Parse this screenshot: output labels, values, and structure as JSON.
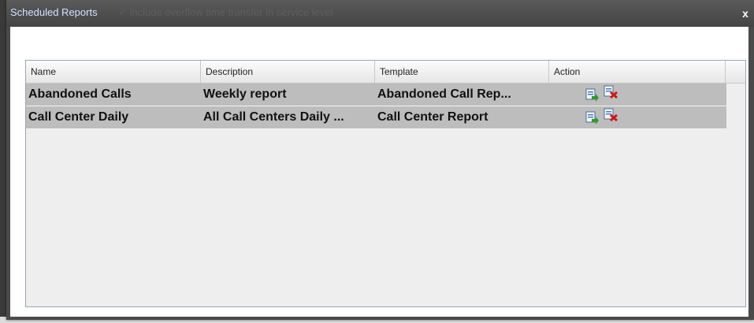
{
  "dialog": {
    "title": "Scheduled Reports",
    "background_text": "✓ include overflow time transfer in service level",
    "close_glyph": "x"
  },
  "grid": {
    "columns": [
      "Name",
      "Description",
      "Template",
      "Action"
    ],
    "rows": [
      {
        "name": "Abandoned Calls",
        "description": "Weekly report",
        "template": "Abandoned Call Rep...",
        "actions": [
          "edit-report-icon",
          "delete-report-icon"
        ]
      },
      {
        "name": "Call Center Daily",
        "description": "All Call Centers Daily ...",
        "template": "Call Center Report",
        "actions": [
          "edit-report-icon",
          "delete-report-icon"
        ]
      }
    ]
  },
  "colors": {
    "title_text": "#cfe3ff",
    "row_background": "#bdbdbd",
    "grid_background": "#eeeeee",
    "delete_icon": "#d01818",
    "edit_icon_arrow": "#2f9a2f"
  }
}
